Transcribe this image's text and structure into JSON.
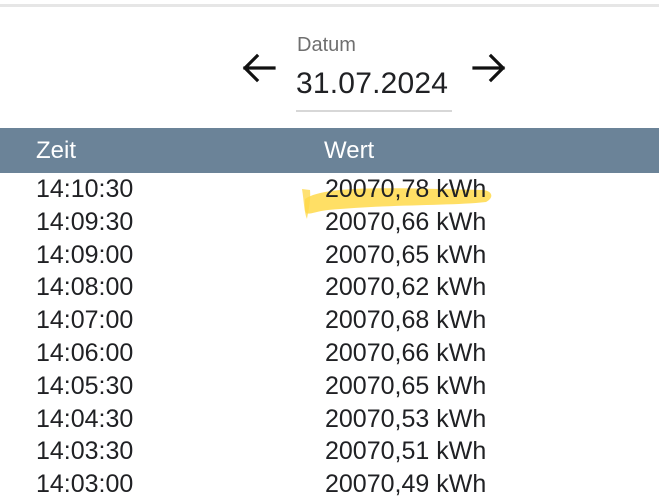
{
  "date_picker": {
    "label": "Datum",
    "value": "31.07.2024",
    "previous_icon": "arrow-left-icon",
    "next_icon": "arrow-right-icon"
  },
  "table": {
    "columns": {
      "time": "Zeit",
      "value": "Wert"
    },
    "rows": [
      {
        "time": "14:10:30",
        "value": "20070,78 kWh"
      },
      {
        "time": "14:09:30",
        "value": "20070,66 kWh"
      },
      {
        "time": "14:09:00",
        "value": "20070,65 kWh"
      },
      {
        "time": "14:08:00",
        "value": "20070,62 kWh"
      },
      {
        "time": "14:07:00",
        "value": "20070,68 kWh"
      },
      {
        "time": "14:06:00",
        "value": "20070,66 kWh"
      },
      {
        "time": "14:05:30",
        "value": "20070,65 kWh"
      },
      {
        "time": "14:04:30",
        "value": "20070,53 kWh"
      },
      {
        "time": "14:03:30",
        "value": "20070,51 kWh"
      },
      {
        "time": "14:03:00",
        "value": "20070,49 kWh"
      }
    ]
  },
  "colors": {
    "header_background": "#6b8398",
    "highlight": "#ffd94a"
  }
}
